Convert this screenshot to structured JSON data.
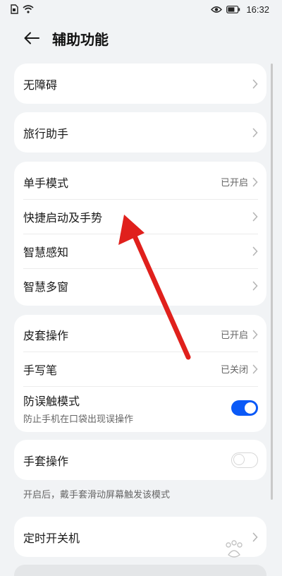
{
  "status_bar": {
    "time": "16:32",
    "left_icons": [
      "sim-icon",
      "wifi-icon"
    ],
    "right_icons": [
      "eye-icon",
      "battery-icon"
    ]
  },
  "header": {
    "title": "辅助功能"
  },
  "groups": [
    {
      "rows": [
        {
          "label": "无障碍"
        }
      ]
    },
    {
      "rows": [
        {
          "label": "旅行助手"
        }
      ]
    },
    {
      "rows": [
        {
          "label": "单手模式",
          "value": "已开启"
        },
        {
          "label": "快捷启动及手势"
        },
        {
          "label": "智慧感知"
        },
        {
          "label": "智慧多窗"
        }
      ]
    },
    {
      "rows": [
        {
          "label": "皮套操作",
          "value": "已开启"
        },
        {
          "label": "手写笔",
          "value": "已关闭"
        },
        {
          "label": "防误触模式",
          "subtitle": "防止手机在口袋出现误操作",
          "toggle": true
        }
      ]
    },
    {
      "rows": [
        {
          "label": "手套操作",
          "toggle": false
        }
      ]
    },
    {
      "rows": [
        {
          "label": "定时开关机"
        }
      ]
    }
  ],
  "glove_hint": "开启后，戴手套滑动屏幕触发该模式",
  "colors": {
    "accent": "#0a59f7",
    "annotation_arrow": "#e0201c"
  }
}
